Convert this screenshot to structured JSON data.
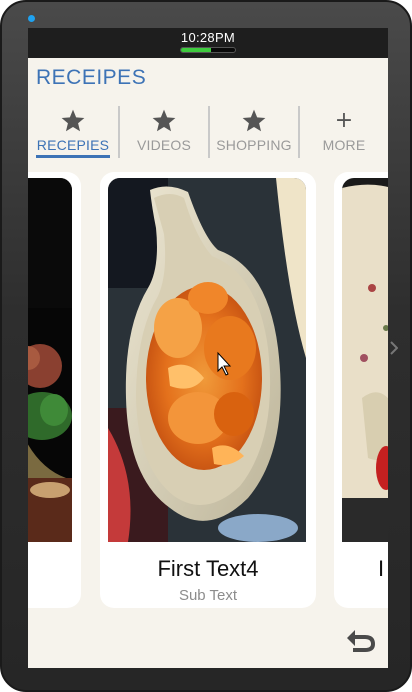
{
  "status_bar": {
    "time": "10:28PM",
    "battery_level_percent": 55
  },
  "page_title": "RECEIPES",
  "tabs": [
    {
      "label": "RECEPIES",
      "icon": "star-icon",
      "active": true
    },
    {
      "label": "VIDEOS",
      "icon": "star-icon",
      "active": false
    },
    {
      "label": "SHOPPING",
      "icon": "star-icon",
      "active": false
    },
    {
      "label": "MORE",
      "icon": "plus-icon",
      "active": false
    }
  ],
  "cards": [
    {
      "title": "",
      "subtitle": ""
    },
    {
      "title": "First Text4",
      "subtitle": "Sub Text"
    },
    {
      "title": "I",
      "subtitle": ""
    }
  ],
  "back_button": {
    "icon": "back-arrow-icon"
  },
  "colors": {
    "accent": "#3d73b6",
    "screen_bg": "#f6f3ec",
    "status_bar": "#1e1e1e"
  }
}
